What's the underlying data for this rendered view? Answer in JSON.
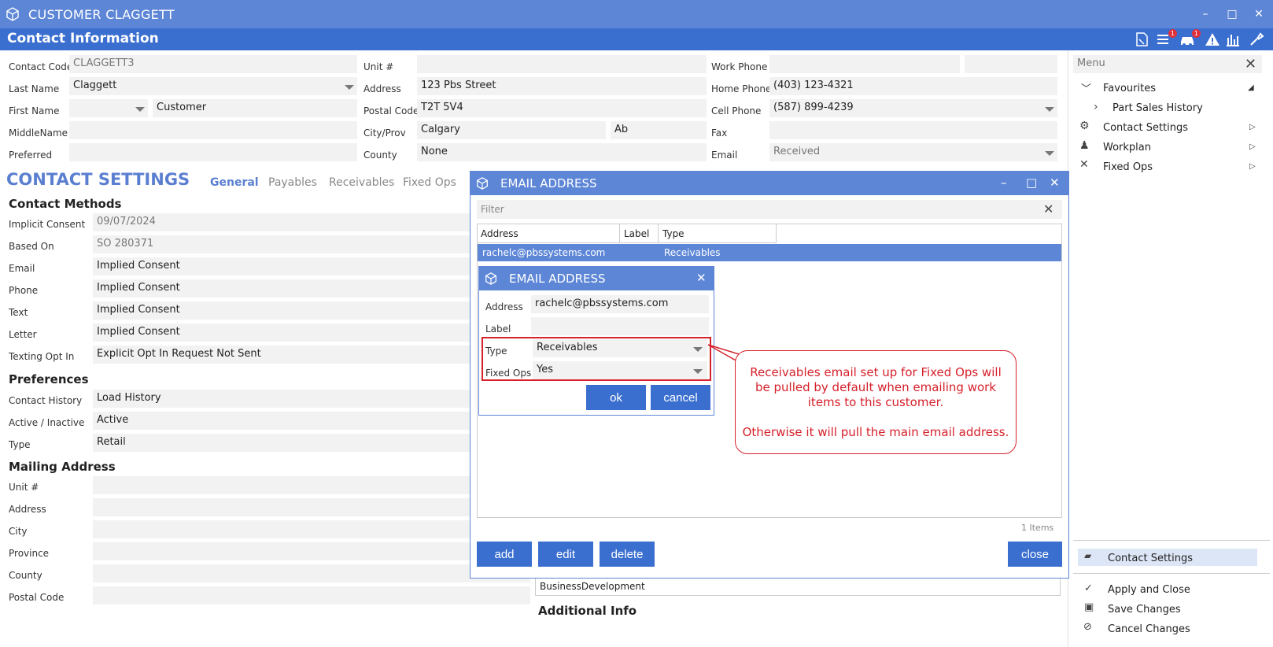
{
  "window": {
    "title": "CUSTOMER CLAGGETT",
    "min": "–",
    "max": "□",
    "close": "✕"
  },
  "header": {
    "title": "Contact Information",
    "badge1": "1",
    "badge2": "1"
  },
  "contact": {
    "code_label": "Contact Code",
    "code_value": "CLAGGETT3",
    "lastname_label": "Last Name",
    "lastname_value": "Claggett",
    "firstname_label": "First Name",
    "firstname_value": "Customer",
    "middlename_label": "MiddleName",
    "preferred_label": "Preferred",
    "unit_label": "Unit #",
    "address_label": "Address",
    "address_value": "123 Pbs Street",
    "postal_label": "Postal Code",
    "postal_value": "T2T 5V4",
    "city_label": "City/Prov",
    "city_value": "Calgary",
    "prov_value": "Ab",
    "county_label": "County",
    "county_value": "None",
    "work_label": "Work Phone",
    "home_label": "Home Phone",
    "home_value": "(403) 123-4321",
    "cell_label": "Cell Phone",
    "cell_value": "(587) 899-4239",
    "fax_label": "Fax",
    "email_label": "Email",
    "email_value": "Received"
  },
  "settings": {
    "title": "CONTACT SETTINGS",
    "tabs": [
      "General",
      "Payables",
      "Receivables",
      "Fixed Ops"
    ],
    "methods_title": "Contact Methods",
    "methods": [
      {
        "label": "Implicit Consent",
        "value": "09/07/2024"
      },
      {
        "label": "Based On",
        "value": "SO 280371"
      },
      {
        "label": "Email",
        "value": "Implied Consent"
      },
      {
        "label": "Phone",
        "value": "Implied Consent"
      },
      {
        "label": "Text",
        "value": "Implied Consent"
      },
      {
        "label": "Letter",
        "value": "Implied Consent"
      },
      {
        "label": "Texting Opt In",
        "value": "Explicit Opt In Request Not Sent"
      }
    ],
    "prefs_title": "Preferences",
    "prefs": [
      {
        "label": "Contact History",
        "value": "Load History"
      },
      {
        "label": "Active / Inactive",
        "value": "Active"
      },
      {
        "label": "Type",
        "value": "Retail"
      }
    ],
    "mailing_title": "Mailing Address",
    "mailing": [
      "Unit #",
      "Address",
      "City",
      "Province",
      "County",
      "Postal Code"
    ],
    "business_value": "BusinessDevelopment",
    "additional_title": "Additional Info"
  },
  "menu": {
    "title": "Menu",
    "favourites": "Favourites",
    "part_sales": "Part Sales History",
    "contact_settings": "Contact Settings",
    "workplan": "Workplan",
    "fixed_ops": "Fixed Ops",
    "selected": "Contact Settings",
    "apply": "Apply and Close",
    "save": "Save Changes",
    "cancel": "Cancel Changes"
  },
  "email_dialog": {
    "title": "EMAIL ADDRESS",
    "filter_placeholder": "Filter",
    "columns": [
      "Address",
      "Label",
      "Type"
    ],
    "rows": [
      {
        "address": "rachelc@pbssystems.com",
        "label": "",
        "type": "Receivables"
      }
    ],
    "count": "1 Items",
    "add": "add",
    "edit": "edit",
    "delete": "delete",
    "close": "close"
  },
  "edit_dialog": {
    "title": "EMAIL ADDRESS",
    "address_label": "Address",
    "address_value": "rachelc@pbssystems.com",
    "label_label": "Label",
    "type_label": "Type",
    "type_value": "Receivables",
    "fixedops_label": "Fixed Ops",
    "fixedops_value": "Yes",
    "ok": "ok",
    "cancel": "cancel"
  },
  "callout": {
    "line1": "Receivables email set up for Fixed Ops will",
    "line2": "be pulled by default when emailing work",
    "line3": "items to this customer.",
    "line4": "Otherwise it will pull the main email address."
  },
  "colors": {
    "accent": "#3a6fd0",
    "title": "#5d86d6",
    "highlight": "#d6202a"
  }
}
